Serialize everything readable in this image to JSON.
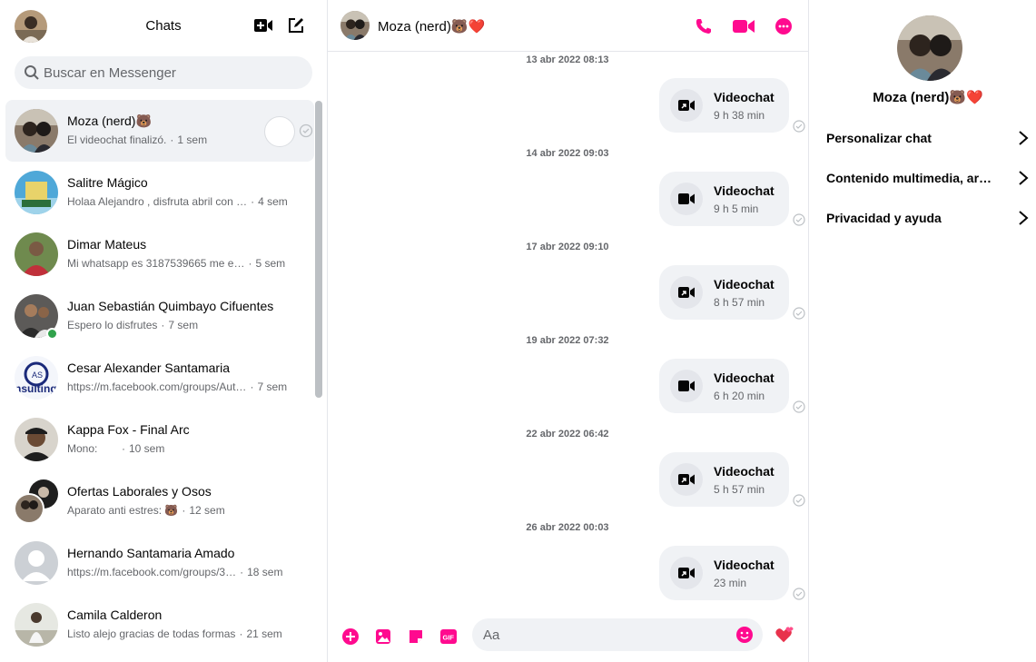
{
  "colors": {
    "accent": "#ff0a8f",
    "online": "#31a24c",
    "muted": "#65676b",
    "bg_gray": "#f0f2f5"
  },
  "sidebar": {
    "title": "Chats",
    "icons": {
      "new_video_room": "video-plus-icon",
      "compose": "compose-icon"
    },
    "search": {
      "placeholder": "Buscar en Messenger"
    },
    "chats": [
      {
        "name": "Moza (nerd)🐻",
        "preview": "El videochat finalizó.",
        "time": "1 sem",
        "active": true,
        "avatar": "couple-selfie"
      },
      {
        "name": "Salitre Mágico",
        "preview": "Holaa Alejandro , disfruta abril con …",
        "time": "4 sem",
        "avatar": "salitre-logo"
      },
      {
        "name": "Dimar Mateus",
        "preview": "Mi whatsapp es 3187539665 me e…",
        "time": "5 sem",
        "avatar": "man-red-shirt"
      },
      {
        "name": "Juan Sebastián Quimbayo Cifuentes",
        "preview": "Espero lo disfrutes",
        "time": "7 sem",
        "online": true,
        "avatar": "group-photo"
      },
      {
        "name": "Cesar Alexander Santamaria",
        "preview": "https://m.facebook.com/groups/Aut…",
        "time": "7 sem",
        "avatar": "consulting-logo"
      },
      {
        "name": "Kappa Fox - Final Arc",
        "preview": "Mono:",
        "time": "10 sem",
        "avatar": "man-cap"
      },
      {
        "name": "Ofertas Laborales y Osos",
        "preview": "Aparato anti estres: 🐻",
        "time": "12 sem",
        "avatar": "group-two"
      },
      {
        "name": "Hernando Santamaria Amado",
        "preview": "https://m.facebook.com/groups/3…",
        "time": "18 sem",
        "avatar": "default-user"
      },
      {
        "name": "Camila Calderon",
        "preview": "Listo alejo gracias de todas formas",
        "time": "21 sem",
        "avatar": "woman-outdoor"
      }
    ]
  },
  "conversation": {
    "name": "Moza (nerd)🐻❤️",
    "header_icons": [
      "phone-icon",
      "video-icon",
      "more-icon"
    ],
    "messages": [
      {
        "timestamp": "13 abr 2022 08:13",
        "title": "Videochat",
        "duration": "9 h 38 min"
      },
      {
        "timestamp": "14 abr 2022 09:03",
        "title": "Videochat",
        "duration": "9 h 5 min"
      },
      {
        "timestamp": "17 abr 2022 09:10",
        "title": "Videochat",
        "duration": "8 h 57 min"
      },
      {
        "timestamp": "19 abr 2022 07:32",
        "title": "Videochat",
        "duration": "6 h 20 min"
      },
      {
        "timestamp": "22 abr 2022 06:42",
        "title": "Videochat",
        "duration": "5 h 57 min"
      },
      {
        "timestamp": "26 abr 2022 00:03",
        "title": "Videochat",
        "duration": "23 min"
      }
    ],
    "composer": {
      "placeholder": "Aa",
      "icons": [
        "plus-circle-icon",
        "image-icon",
        "sticker-icon",
        "gif-icon",
        "emoji-icon",
        "heart-icon"
      ],
      "gif_label": "GIF"
    }
  },
  "info_panel": {
    "name": "Moza (nerd)🐻❤️",
    "rows": [
      {
        "label": "Personalizar chat"
      },
      {
        "label": "Contenido multimedia, ar…"
      },
      {
        "label": "Privacidad y ayuda"
      }
    ]
  }
}
